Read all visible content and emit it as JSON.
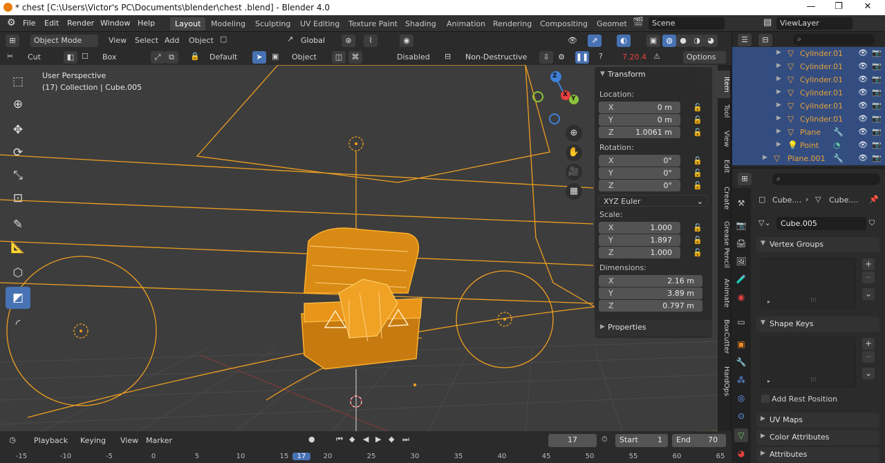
{
  "window": {
    "title": "* chest  [C:\\Users\\Victor's PC\\Documents\\blender\\chest .blend] - Blender 4.0",
    "min": "—",
    "max": "❐",
    "close": "✕"
  },
  "menus": [
    "File",
    "Edit",
    "Render",
    "Window",
    "Help"
  ],
  "workspaces": [
    "Layout",
    "Modeling",
    "Sculpting",
    "UV Editing",
    "Texture Paint",
    "Shading",
    "Animation",
    "Rendering",
    "Compositing",
    "Geomet"
  ],
  "scene": {
    "label": "Scene"
  },
  "viewlayer": {
    "label": "ViewLayer"
  },
  "vpheader": {
    "mode": "Object Mode",
    "view": "View",
    "select": "Select",
    "add": "Add",
    "object": "Object",
    "orientation": "Global"
  },
  "toolheader": {
    "cut": "Cut",
    "box": "Box",
    "default": "Default",
    "object": "Object",
    "disabled": "Disabled",
    "nondestructive": "Non-Destructive",
    "version": "7.20.4",
    "options": "Options"
  },
  "viewport": {
    "perspective": "User Perspective",
    "collection": "(17) Collection | Cube.005",
    "gizmo": {
      "x": "X",
      "y": "Y",
      "z": "Z"
    }
  },
  "npanel": {
    "transform": "Transform",
    "location_label": "Location:",
    "location": [
      {
        "ax": "X",
        "val": "0 m"
      },
      {
        "ax": "Y",
        "val": "0 m"
      },
      {
        "ax": "Z",
        "val": "1.0061 m"
      }
    ],
    "rotation_label": "Rotation:",
    "rotation": [
      {
        "ax": "X",
        "val": "0°"
      },
      {
        "ax": "Y",
        "val": "0°"
      },
      {
        "ax": "Z",
        "val": "0°"
      }
    ],
    "rotation_mode": "XYZ Euler",
    "scale_label": "Scale:",
    "scale": [
      {
        "ax": "X",
        "val": "1.000"
      },
      {
        "ax": "Y",
        "val": "1.897"
      },
      {
        "ax": "Z",
        "val": "1.000"
      }
    ],
    "dimensions_label": "Dimensions:",
    "dimensions": [
      {
        "ax": "X",
        "val": "2.16 m"
      },
      {
        "ax": "Y",
        "val": "3.89 m"
      },
      {
        "ax": "Z",
        "val": "0.797 m"
      }
    ],
    "properties": "Properties"
  },
  "sidetabs": [
    "Item",
    "Tool",
    "View",
    "Edit",
    "Create",
    "Grease Pencil",
    "Animate",
    "BoxCutter",
    "HardOps"
  ],
  "outliner": {
    "rows": [
      "Cylinder.01",
      "Cylinder.01",
      "Cylinder.01",
      "Cylinder.01",
      "Cylinder.01",
      "Cylinder.01",
      "Plane",
      "Point",
      "Plane.001"
    ]
  },
  "props": {
    "crumb1": "Cube....",
    "crumb2": "Cube....",
    "mesh_name": "Cube.005",
    "vertex_groups": "Vertex Groups",
    "shape_keys": "Shape Keys",
    "add_rest": "Add Rest Position",
    "uv_maps": "UV Maps",
    "color_attributes": "Color Attributes",
    "attributes": "Attributes"
  },
  "timeline": {
    "playback": "Playback",
    "keying": "Keying",
    "view": "View",
    "marker": "Marker",
    "current": "17",
    "start_label": "Start",
    "start": "1",
    "end_label": "End",
    "end": "70",
    "ticks": [
      "-15",
      "-10",
      "-5",
      "0",
      "5",
      "10",
      "15",
      "17",
      "20",
      "25",
      "30",
      "35",
      "40",
      "45",
      "50",
      "55",
      "60",
      "65"
    ]
  },
  "colors": {
    "accent": "#4772b3",
    "selection": "#ffa21f"
  }
}
